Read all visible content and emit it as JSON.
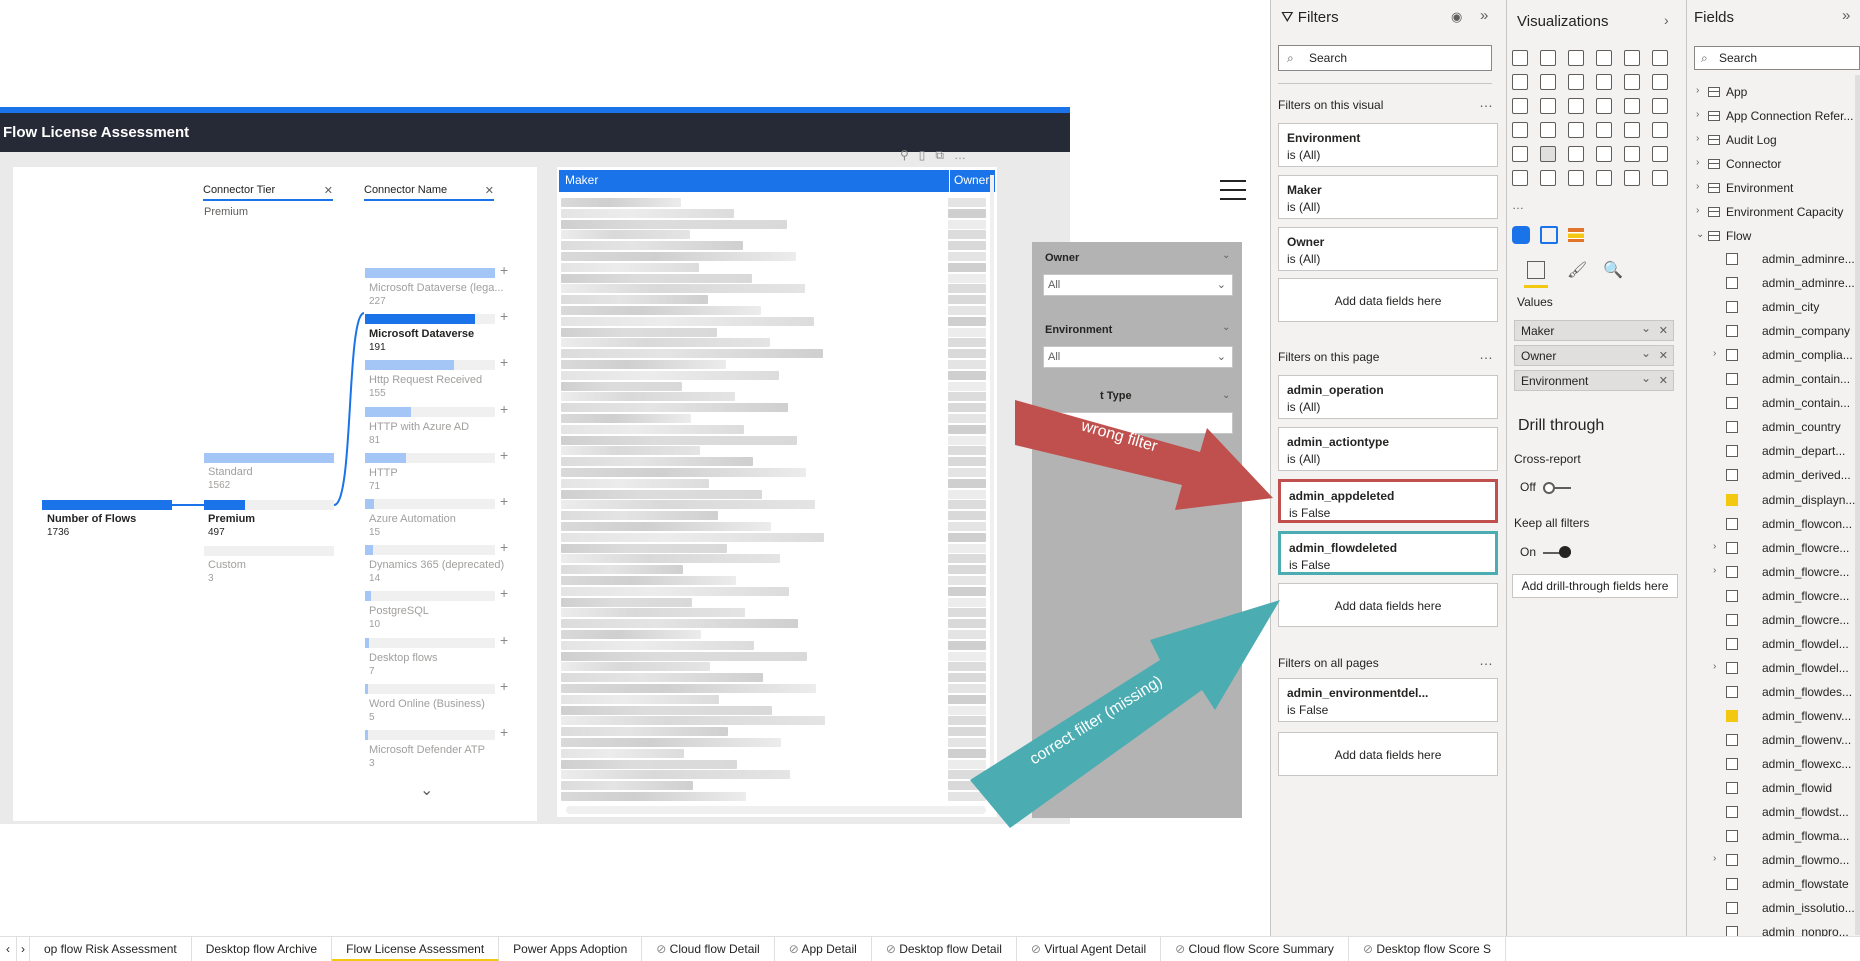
{
  "report": {
    "title": "Flow License Assessment"
  },
  "decomposition": {
    "header1": "Connector Tier",
    "header1_value": "Premium",
    "header2": "Connector Name",
    "root": {
      "name": "Number of Flows",
      "value": "1736"
    },
    "tiers": [
      {
        "name": "Standard",
        "value": "1562",
        "selected": false
      },
      {
        "name": "Premium",
        "value": "497",
        "selected": true
      },
      {
        "name": "Custom",
        "value": "3",
        "selected": false
      }
    ],
    "connectors": [
      {
        "name": "Microsoft Dataverse (lega...",
        "value": "227",
        "selected": false
      },
      {
        "name": "Microsoft Dataverse",
        "value": "191",
        "selected": true
      },
      {
        "name": "Http Request Received",
        "value": "155",
        "selected": false
      },
      {
        "name": "HTTP with Azure AD",
        "value": "81",
        "selected": false
      },
      {
        "name": "HTTP",
        "value": "71",
        "selected": false
      },
      {
        "name": "Azure Automation",
        "value": "15",
        "selected": false
      },
      {
        "name": "Dynamics 365 (deprecated)",
        "value": "14",
        "selected": false
      },
      {
        "name": "PostgreSQL",
        "value": "10",
        "selected": false
      },
      {
        "name": "Desktop flows",
        "value": "7",
        "selected": false
      },
      {
        "name": "Word Online (Business)",
        "value": "5",
        "selected": false
      },
      {
        "name": "Microsoft Defender ATP",
        "value": "3",
        "selected": false
      }
    ]
  },
  "table": {
    "col1": "Maker",
    "col2": "Owner"
  },
  "slicers": {
    "owner_label": "Owner",
    "owner_value": "All",
    "env_label": "Environment",
    "env_value": "All",
    "type_label": "t Type"
  },
  "annotations": {
    "wrong": "wrong filter",
    "correct": "correct filter (missing)",
    "wrong_color": "#c0504d",
    "correct_color": "#4bacb2"
  },
  "filters": {
    "title": "Filters",
    "search_placeholder": "Search",
    "on_visual_label": "Filters on this visual",
    "visual_filters": [
      {
        "name": "Environment",
        "state": "is (All)"
      },
      {
        "name": "Maker",
        "state": "is (All)"
      },
      {
        "name": "Owner",
        "state": "is (All)"
      }
    ],
    "add_fields": "Add data fields here",
    "on_page_label": "Filters on this page",
    "page_filters": [
      {
        "name": "admin_operation",
        "state": "is (All)"
      },
      {
        "name": "admin_actiontype",
        "state": "is (All)"
      },
      {
        "name": "admin_appdeleted",
        "state": "is False"
      },
      {
        "name": "admin_flowdeleted",
        "state": "is False"
      }
    ],
    "on_all_label": "Filters on all pages",
    "all_filters": [
      {
        "name": "admin_environmentdel...",
        "state": "is False"
      }
    ]
  },
  "visualizations": {
    "title": "Visualizations",
    "values_label": "Values",
    "wells": [
      "Maker",
      "Owner",
      "Environment"
    ],
    "drill_title": "Drill through",
    "cross_report": "Cross-report",
    "cross_state": "Off",
    "keep_filters": "Keep all filters",
    "keep_state": "On",
    "drill_add": "Add drill-through fields here"
  },
  "fields": {
    "title": "Fields",
    "search_placeholder": "Search",
    "tables": [
      "App",
      "App Connection Refer...",
      "Audit Log",
      "Connector",
      "Environment",
      "Environment Capacity",
      "Flow"
    ],
    "flow_fields": [
      {
        "name": "admin_adminre...",
        "checked": false
      },
      {
        "name": "admin_adminre...",
        "checked": false
      },
      {
        "name": "admin_city",
        "checked": false
      },
      {
        "name": "admin_company",
        "checked": false
      },
      {
        "name": "admin_complia...",
        "checked": false
      },
      {
        "name": "admin_contain...",
        "checked": false
      },
      {
        "name": "admin_contain...",
        "checked": false
      },
      {
        "name": "admin_country",
        "checked": false
      },
      {
        "name": "admin_depart...",
        "checked": false
      },
      {
        "name": "admin_derived...",
        "checked": false
      },
      {
        "name": "admin_displayn...",
        "checked": true
      },
      {
        "name": "admin_flowcon...",
        "checked": false
      },
      {
        "name": "admin_flowcre...",
        "checked": false
      },
      {
        "name": "admin_flowcre...",
        "checked": false
      },
      {
        "name": "admin_flowcre...",
        "checked": false
      },
      {
        "name": "admin_flowcre...",
        "checked": false
      },
      {
        "name": "admin_flowdel...",
        "checked": false
      },
      {
        "name": "admin_flowdel...",
        "checked": false
      },
      {
        "name": "admin_flowdes...",
        "checked": false
      },
      {
        "name": "admin_flowenv...",
        "checked": true
      },
      {
        "name": "admin_flowenv...",
        "checked": false
      },
      {
        "name": "admin_flowexc...",
        "checked": false
      },
      {
        "name": "admin_flowid",
        "checked": false
      },
      {
        "name": "admin_flowdst...",
        "checked": false
      },
      {
        "name": "admin_flowma...",
        "checked": false
      },
      {
        "name": "admin_flowmo...",
        "checked": false
      },
      {
        "name": "admin_flowstate",
        "checked": false
      },
      {
        "name": "admin_issolutio...",
        "checked": false
      },
      {
        "name": "admin_nonpro...",
        "checked": false
      }
    ]
  },
  "tabs": [
    {
      "label": "op flow Risk Assessment",
      "active": false
    },
    {
      "label": "Desktop flow Archive",
      "active": false
    },
    {
      "label": "Flow License Assessment",
      "active": true
    },
    {
      "label": "Power Apps Adoption",
      "active": false
    },
    {
      "label": "Cloud flow Detail",
      "active": false
    },
    {
      "label": "App Detail",
      "active": false
    },
    {
      "label": "Desktop flow Detail",
      "active": false
    },
    {
      "label": "Virtual Agent Detail",
      "active": false
    },
    {
      "label": "Cloud flow Score Summary",
      "active": false
    },
    {
      "label": "Desktop flow Score S",
      "active": false
    }
  ]
}
